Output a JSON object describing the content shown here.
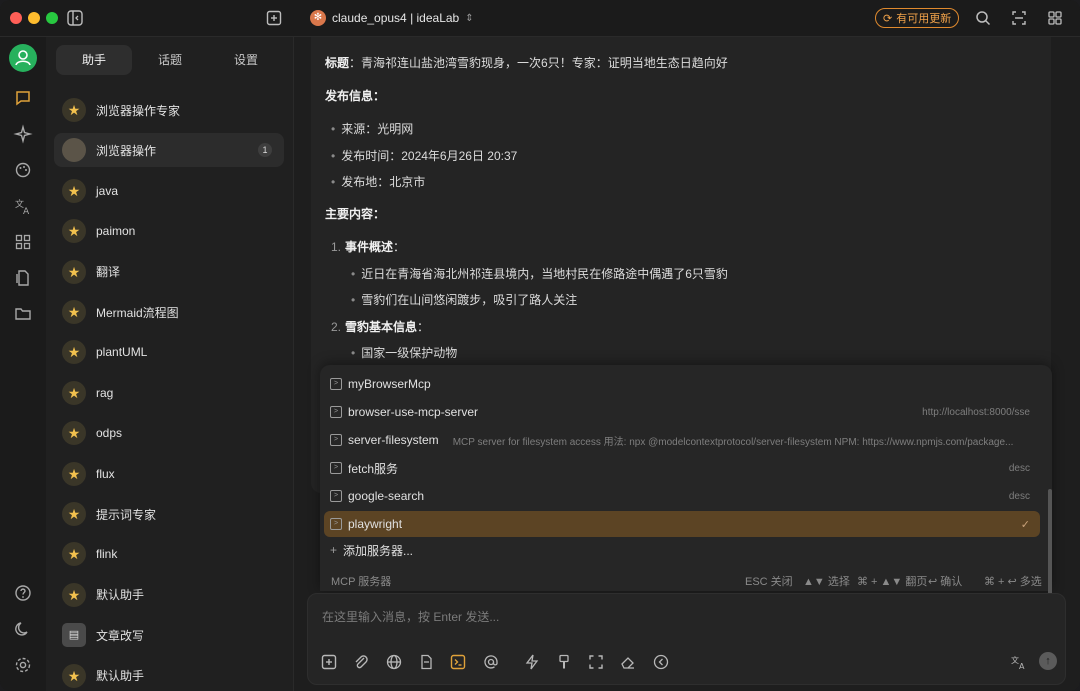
{
  "titlebar": {
    "model": "claude_opus4 | ideaLab",
    "update_label": "有可用更新"
  },
  "panel": {
    "tabs": [
      "助手",
      "话题",
      "设置"
    ],
    "assistants": [
      {
        "label": "浏览器操作专家",
        "icon": "star"
      },
      {
        "label": "浏览器操作",
        "icon": "plain",
        "badge": "1"
      },
      {
        "label": "java",
        "icon": "star"
      },
      {
        "label": "paimon",
        "icon": "star"
      },
      {
        "label": "翻译",
        "icon": "star"
      },
      {
        "label": "Mermaid流程图",
        "icon": "star"
      },
      {
        "label": "plantUML",
        "icon": "star"
      },
      {
        "label": "rag",
        "icon": "star"
      },
      {
        "label": "odps",
        "icon": "star"
      },
      {
        "label": "flux",
        "icon": "star"
      },
      {
        "label": "提示词专家",
        "icon": "star"
      },
      {
        "label": "flink",
        "icon": "star"
      },
      {
        "label": "默认助手",
        "icon": "star"
      },
      {
        "label": "文章改写",
        "icon": "doc"
      },
      {
        "label": "默认助手",
        "icon": "star"
      }
    ]
  },
  "message": {
    "title_label": "标题",
    "title_text": "青海祁连山盐池湾雪豹现身，一次6只！专家：证明当地生态日趋向好",
    "publish_heading": "发布信息",
    "publish": [
      {
        "k": "来源",
        "v": "光明网"
      },
      {
        "k": "发布时间",
        "v": "2024年6月26日 20:37"
      },
      {
        "k": "发布地",
        "v": "北京市"
      }
    ],
    "content_heading": "主要内容",
    "sections": [
      {
        "num": "1.",
        "title": "事件概述",
        "items": [
          "近日在青海省海北州祁连县境内，当地村民在修路途中偶遇了6只雪豹",
          "雪豹们在山间悠闲踱步，吸引了路人关注"
        ]
      },
      {
        "num": "2.",
        "title": "雪豹基本信息",
        "items": [
          "国家一级保护动物"
        ]
      }
    ]
  },
  "mcp": {
    "servers": [
      {
        "name": "myBrowserMcp",
        "desc": ""
      },
      {
        "name": "browser-use-mcp-server",
        "desc": "http://localhost:8000/sse"
      },
      {
        "name": "server-filesystem",
        "desc": "MCP server for filesystem access 用法: npx @modelcontextprotocol/server-filesystem NPM: https://www.npmjs.com/package..."
      },
      {
        "name": "fetch服务",
        "desc": "desc"
      },
      {
        "name": "google-search",
        "desc": "desc"
      },
      {
        "name": "playwright",
        "desc": "",
        "active": true
      }
    ],
    "add_label": "添加服务器...",
    "footer_left": "MCP 服务器",
    "hints": [
      "ESC 关闭",
      "▲▼ 选择",
      "⌘ + ▲▼ 翻页",
      "↩ 确认",
      "⌘ + ↩ 多选"
    ]
  },
  "input": {
    "placeholder": "在这里输入消息，按 Enter 发送..."
  }
}
